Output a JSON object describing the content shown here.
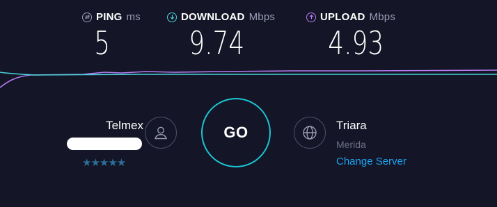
{
  "metrics": {
    "ping": {
      "label": "PING",
      "unit": "ms",
      "value": "5",
      "icon": "ping-icon",
      "color": "#9a9cb5"
    },
    "download": {
      "label": "DOWNLOAD",
      "unit": "Mbps",
      "value": "9.74",
      "icon": "download-arrow-icon",
      "color": "#49d4d9"
    },
    "upload": {
      "label": "UPLOAD",
      "unit": "Mbps",
      "value": "4.93",
      "icon": "upload-arrow-icon",
      "color": "#b57cf2"
    }
  },
  "colors": {
    "background": "#141526",
    "go_ring": "#1bc6d4",
    "link": "#1ea3f0",
    "stars": "#2a6f9a",
    "download_line": "#49d4d9",
    "upload_line": "#b57cf2"
  },
  "isp": {
    "name": "Telmex",
    "rating_stars": "★★★★★",
    "icon": "person-icon"
  },
  "go_button": {
    "label": "GO"
  },
  "server": {
    "name": "Triara",
    "location": "Merida",
    "change_label": "Change Server",
    "icon": "globe-icon"
  }
}
